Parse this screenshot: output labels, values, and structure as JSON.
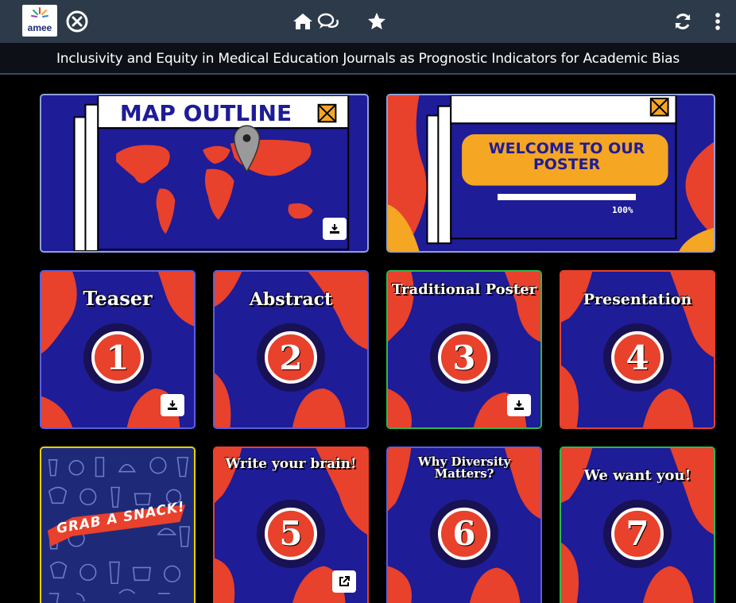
{
  "topbar": {
    "logo_text": "amee",
    "icons": [
      "close-circle-icon",
      "home-icon",
      "chat-icon",
      "star-icon",
      "refresh-icon",
      "more-vertical-icon"
    ]
  },
  "poster_title": "Inclusivity and Equity in Medical Education Journals as Prognostic Indicators for Academic Bias",
  "hero": {
    "map": {
      "heading": "MAP OUTLINE"
    },
    "welcome": {
      "heading": "WELCOME TO OUR POSTER",
      "progress_value": 1.0,
      "progress_text": "100%"
    }
  },
  "tiles": [
    {
      "label": "Teaser",
      "number": "1",
      "action": "download-icon"
    },
    {
      "label": "Abstract",
      "number": "2",
      "action": ""
    },
    {
      "label": "Traditional Poster",
      "number": "3",
      "action": "download-icon"
    },
    {
      "label": "Presentation",
      "number": "4",
      "action": ""
    },
    {
      "label": "GRAB A SNACK!",
      "number": "",
      "action": ""
    },
    {
      "label": "Write your brain!",
      "number": "5",
      "action": "external-link-icon"
    },
    {
      "label": "Why Diversity Matters?",
      "number": "6",
      "action": ""
    },
    {
      "label": "We want you!",
      "number": "7",
      "action": ""
    }
  ],
  "colors": {
    "navy": "#1e1c96",
    "orange": "#e8412c",
    "amber": "#f5a623",
    "topbar": "#2d3a4a"
  }
}
